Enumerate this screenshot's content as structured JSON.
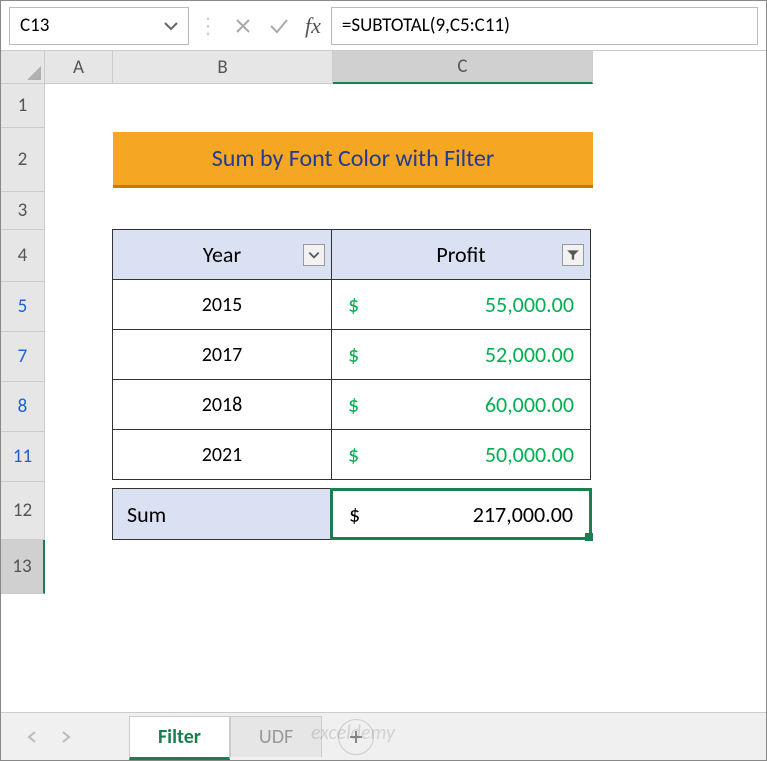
{
  "name_box": "C13",
  "formula": "=SUBTOTAL(9,C5:C11)",
  "columns": [
    "A",
    "B",
    "C"
  ],
  "row_labels": [
    "1",
    "2",
    "3",
    "4",
    "5",
    "7",
    "8",
    "11",
    "12",
    "13"
  ],
  "banner": "Sum by Font Color with Filter",
  "headers": {
    "year": "Year",
    "profit": "Profit"
  },
  "rows": [
    {
      "year": "2015",
      "currency": "$",
      "amount": "55,000.00"
    },
    {
      "year": "2017",
      "currency": "$",
      "amount": "52,000.00"
    },
    {
      "year": "2018",
      "currency": "$",
      "amount": "60,000.00"
    },
    {
      "year": "2021",
      "currency": "$",
      "amount": "50,000.00"
    }
  ],
  "sum": {
    "label": "Sum",
    "currency": "$",
    "amount": "217,000.00"
  },
  "tabs": {
    "active": "Filter",
    "other": "UDF"
  },
  "watermark": "exceldemy",
  "chart_data": {
    "type": "table",
    "title": "Sum by Font Color with Filter",
    "columns": [
      "Year",
      "Profit"
    ],
    "rows": [
      [
        "2015",
        55000.0
      ],
      [
        "2017",
        52000.0
      ],
      [
        "2018",
        60000.0
      ],
      [
        "2021",
        50000.0
      ]
    ],
    "summary": {
      "label": "Sum",
      "value": 217000.0
    },
    "formula": "=SUBTOTAL(9,C5:C11)",
    "active_cell": "C13",
    "hidden_rows": [
      6,
      9,
      10
    ]
  }
}
